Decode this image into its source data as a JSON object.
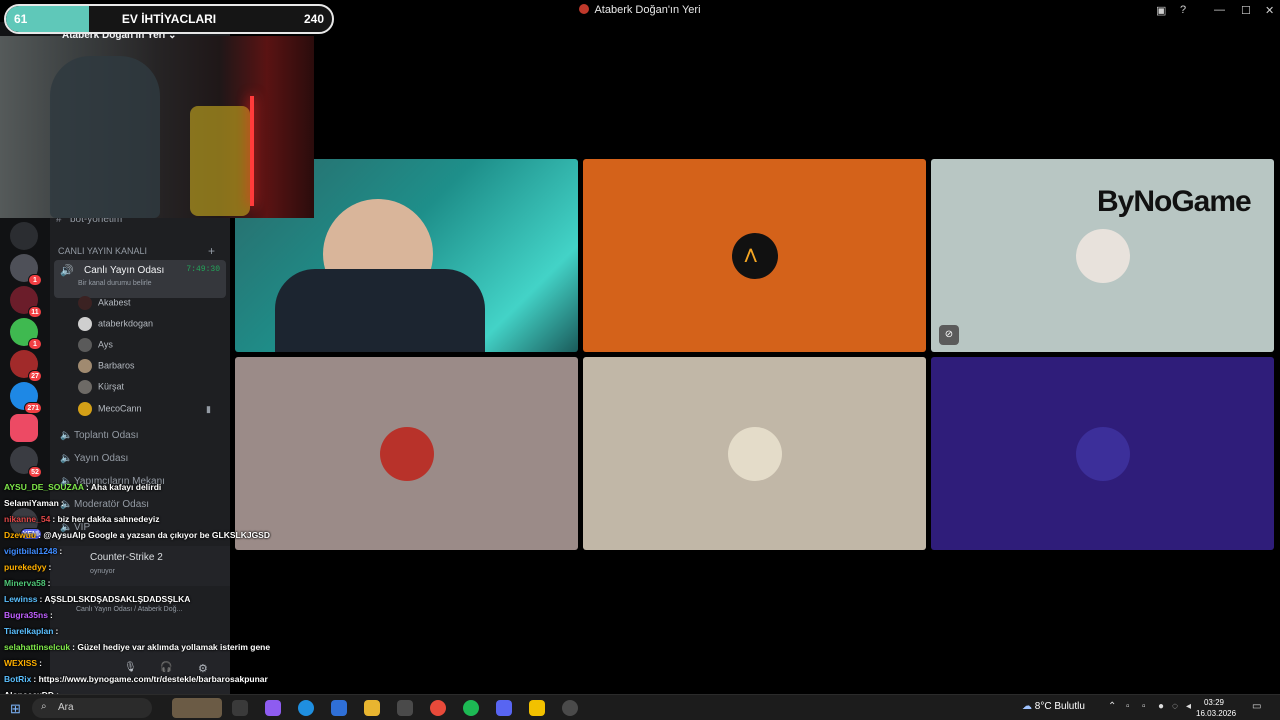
{
  "window": {
    "title": "Ataberk Doğan'ın Yeri"
  },
  "server": {
    "name": "Ataberk Doğan'ın Yeri"
  },
  "server_rail": {
    "badges": [
      "1",
      "11",
      "1",
      "27",
      "271",
      "52",
      "YENİ"
    ]
  },
  "sidebar": {
    "text_channels": [
      {
        "name": "bot-yönetim"
      }
    ],
    "category": "CANLI YAYIN KANALI",
    "voice_channels": [
      {
        "name": "Canlı Yayın Odası",
        "timer": "7:49:30",
        "status": "Bir kanal durumu belirle"
      },
      {
        "name": "Toplantı Odası"
      },
      {
        "name": "Yayın Odası"
      },
      {
        "name": "Yapımcıların Mekanı"
      },
      {
        "name": "Moderatör Odası"
      },
      {
        "name": "VIP"
      }
    ],
    "voice_users": [
      "Akabest",
      "ataberkdogan",
      "Ays",
      "Barbaros",
      "Kürşat",
      "MecoCann"
    ]
  },
  "activity": {
    "game": "Counter-Strike 2",
    "subtitle": "oynuyor",
    "voice_status": "Canlı Yayın Odası / Ataberk Doğ..."
  },
  "stage": {
    "tiles": [
      {
        "label": "camera",
        "bg": "#1a5a5a"
      },
      {
        "label": "orange",
        "bg": "#d4621a"
      },
      {
        "label": "bynogame",
        "bg": "#b8c6c3",
        "brand": "ByNoGame"
      },
      {
        "label": "tile4",
        "bg": "#9b8b88"
      },
      {
        "label": "tile5",
        "bg": "#c1b7a7"
      },
      {
        "label": "tile6",
        "bg": "#2f1d7a"
      }
    ]
  },
  "goal": {
    "current": "61",
    "title": "EV İHTİYACLARI",
    "target": "240",
    "progress_fraction": 0.254,
    "fill_color": "#5fc8b9"
  },
  "chat": {
    "messages": [
      {
        "user": "AYSU_DE_SOUZAA",
        "text": ": Aha kafayı delirdi",
        "color": "#7fe84a"
      },
      {
        "user": "SelamiYaman",
        "text": ":",
        "color": "#ffffff"
      },
      {
        "user": "nikanne_54",
        "text": ": biz her dakka sahnedeyiz",
        "color": "#e04848"
      },
      {
        "user": "Dzewuu",
        "text": ": @AysuAlp Google a yazsan da çıkıyor be GLKSLKJGSD",
        "color": "#ffb000"
      },
      {
        "user": "vigitbilal1248",
        "text": ":",
        "color": "#3f8cff"
      },
      {
        "user": "purekedyy",
        "text": ":",
        "color": "#ffb000"
      },
      {
        "user": "Minerva58",
        "text": ":",
        "color": "#50c878"
      },
      {
        "user": "Lewinss",
        "text": ": AŞSLDLSKDŞADSAKLŞDADSŞLKA",
        "color": "#5bc0ff"
      },
      {
        "user": "Bugra35ns",
        "text": ":",
        "color": "#c060ff"
      },
      {
        "user": "Tiarelkaplan",
        "text": ":",
        "color": "#5bc0ff"
      },
      {
        "user": "selahattinselcuk",
        "text": ": Güzel hediye var aklımda yollamak isterim gene",
        "color": "#7fe84a"
      },
      {
        "user": "WEXISS",
        "text": ":",
        "color": "#ffb000"
      },
      {
        "user": "BotRix",
        "text": ": https://www.bynogame.com/tr/destekle/barbarosakpunar",
        "color": "#5bc0ff"
      },
      {
        "user": "AloneeexDD",
        "text": ":",
        "color": "#ffffff"
      }
    ]
  },
  "taskbar": {
    "search_placeholder": "Ara",
    "weather": "8°C  Bulutlu",
    "time": "03:29",
    "date": "16.03.2026"
  }
}
